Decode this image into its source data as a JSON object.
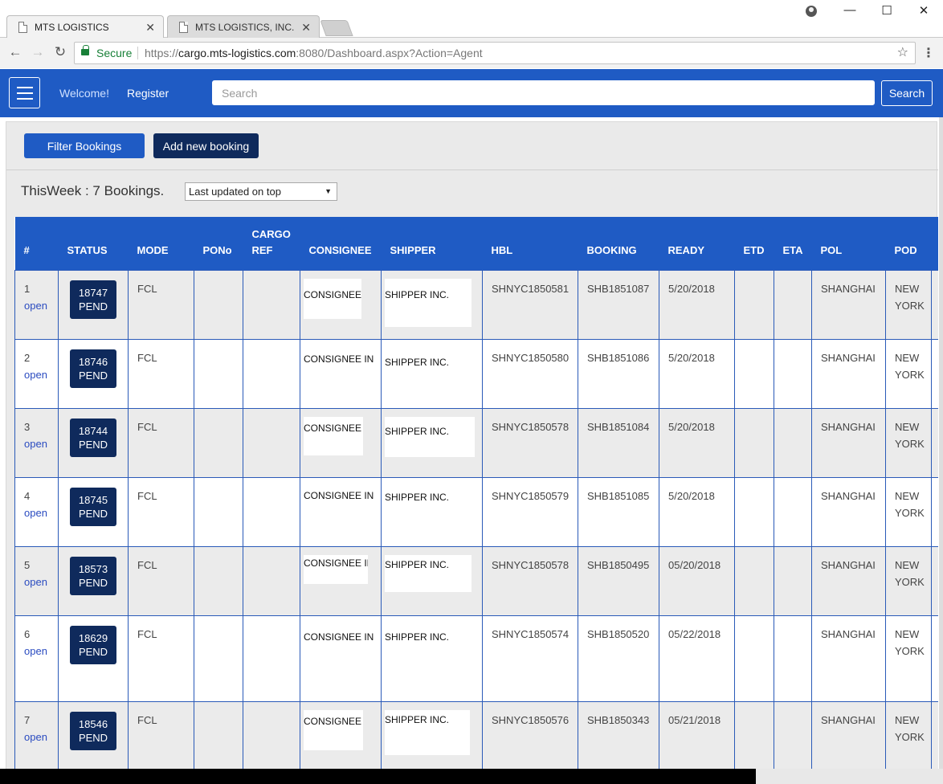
{
  "browser": {
    "tabs": [
      {
        "title": "MTS LOGISTICS",
        "active": true
      },
      {
        "title": "MTS LOGISTICS, INC.",
        "active": false
      }
    ],
    "secure_label": "Secure",
    "url_scheme": "https://",
    "url_host": "cargo.mts-logistics.com",
    "url_rest": ":8080/Dashboard.aspx?Action=Agent"
  },
  "nav": {
    "welcome": "Welcome!",
    "register": "Register",
    "search_placeholder": "Search",
    "search_button": "Search"
  },
  "actions": {
    "filter": "Filter Bookings",
    "add": "Add new booking"
  },
  "summary": "ThisWeek : 7 Bookings.",
  "sort": {
    "selected": "Last updated on top"
  },
  "table": {
    "headers": [
      "#",
      "STATUS",
      "MODE",
      "PONo",
      "CARGO REF",
      "CONSIGNEE",
      "SHIPPER",
      "HBL",
      "BOOKING",
      "READY",
      "ETD",
      "ETA",
      "POL",
      "POD"
    ],
    "rows": [
      {
        "num": "1",
        "link": "open",
        "status_id": "18747",
        "status": "PEND",
        "mode": "FCL",
        "pono": "",
        "cargo_ref": "",
        "consignee": "CONSIGNEE IN",
        "shipper": "SHIPPER INC.",
        "hbl": "SHNYC1850581",
        "booking": "SHB1851087",
        "ready": "5/20/2018",
        "etd": "",
        "eta": "",
        "pol": "SHANGHAI",
        "pod": "NEW YORK"
      },
      {
        "num": "2",
        "link": "open",
        "status_id": "18746",
        "status": "PEND",
        "mode": "FCL",
        "pono": "",
        "cargo_ref": "",
        "consignee": "CONSIGNEE IN",
        "shipper": "SHIPPER INC.",
        "hbl": "SHNYC1850580",
        "booking": "SHB1851086",
        "ready": "5/20/2018",
        "etd": "",
        "eta": "",
        "pol": "SHANGHAI",
        "pod": "NEW YORK"
      },
      {
        "num": "3",
        "link": "open",
        "status_id": "18744",
        "status": "PEND",
        "mode": "FCL",
        "pono": "",
        "cargo_ref": "",
        "consignee": "CONSIGNEE IN",
        "shipper": "SHIPPER INC.",
        "hbl": "SHNYC1850578",
        "booking": "SHB1851084",
        "ready": "5/20/2018",
        "etd": "",
        "eta": "",
        "pol": "SHANGHAI",
        "pod": "NEW YORK"
      },
      {
        "num": "4",
        "link": "open",
        "status_id": "18745",
        "status": "PEND",
        "mode": "FCL",
        "pono": "",
        "cargo_ref": "",
        "consignee": "CONSIGNEE IN",
        "shipper": "SHIPPER INC.",
        "hbl": "SHNYC1850579",
        "booking": "SHB1851085",
        "ready": "5/20/2018",
        "etd": "",
        "eta": "",
        "pol": "SHANGHAI",
        "pod": "NEW YORK"
      },
      {
        "num": "5",
        "link": "open",
        "status_id": "18573",
        "status": "PEND",
        "mode": "FCL",
        "pono": "",
        "cargo_ref": "",
        "consignee": "CONSIGNEE IN",
        "shipper": "SHIPPER INC.",
        "hbl": "SHNYC1850578",
        "booking": "SHB1850495",
        "ready": "05/20/2018",
        "etd": "",
        "eta": "",
        "pol": "SHANGHAI",
        "pod": "NEW YORK"
      },
      {
        "num": "6",
        "link": "open",
        "status_id": "18629",
        "status": "PEND",
        "mode": "FCL",
        "pono": "",
        "cargo_ref": "",
        "consignee": "CONSIGNEE IN",
        "shipper": "SHIPPER INC.",
        "hbl": "SHNYC1850574",
        "booking": "SHB1850520",
        "ready": "05/22/2018",
        "etd": "",
        "eta": "",
        "pol": "SHANGHAI",
        "pod": "NEW YORK"
      },
      {
        "num": "7",
        "link": "open",
        "status_id": "18546",
        "status": "PEND",
        "mode": "FCL",
        "pono": "",
        "cargo_ref": "",
        "consignee": "CONSIGNEE IN",
        "shipper": "SHIPPER INC.",
        "hbl": "SHNYC1850576",
        "booking": "SHB1850343",
        "ready": "05/21/2018",
        "etd": "",
        "eta": "",
        "pol": "SHANGHAI",
        "pod": "NEW YORK"
      }
    ]
  },
  "colors": {
    "brand_blue": "#1f5bc4",
    "dark_navy": "#0f2a5c",
    "link_blue": "#2a4bc0",
    "secure_green": "#188038"
  }
}
